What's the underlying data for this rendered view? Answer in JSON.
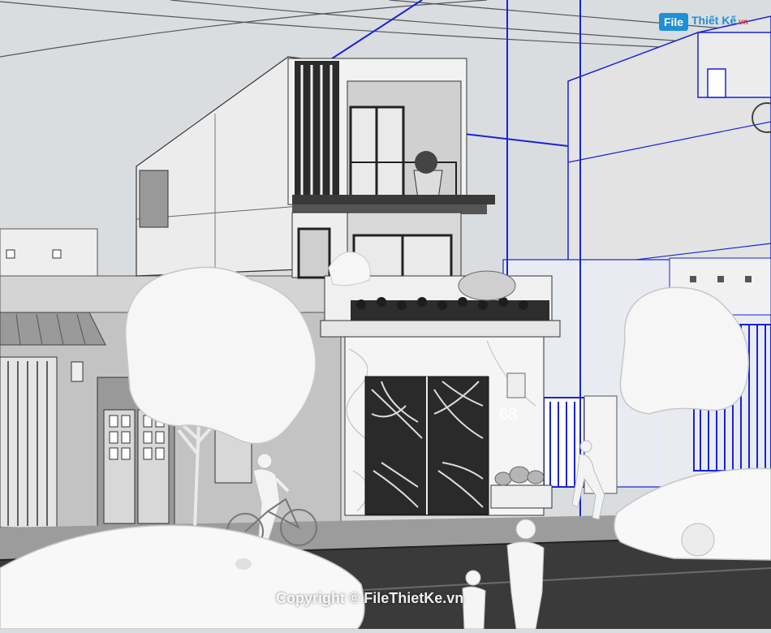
{
  "watermark": {
    "logo_file": "File",
    "logo_name": "Thiết Kế",
    "logo_tld": ".vn",
    "copyright": "Copyright © FileThietKe.vn"
  },
  "house": {
    "number": "68"
  },
  "colors": {
    "sky": "#d9dde0",
    "guide_lines": "#1a22d6",
    "building_white": "#f4f4f4",
    "building_gray": "#c9c9c9",
    "dark_trim": "#2b2b2b",
    "road": "#3a3a3a",
    "logo_blue": "#1f8fd6",
    "logo_red": "#e0392b"
  }
}
